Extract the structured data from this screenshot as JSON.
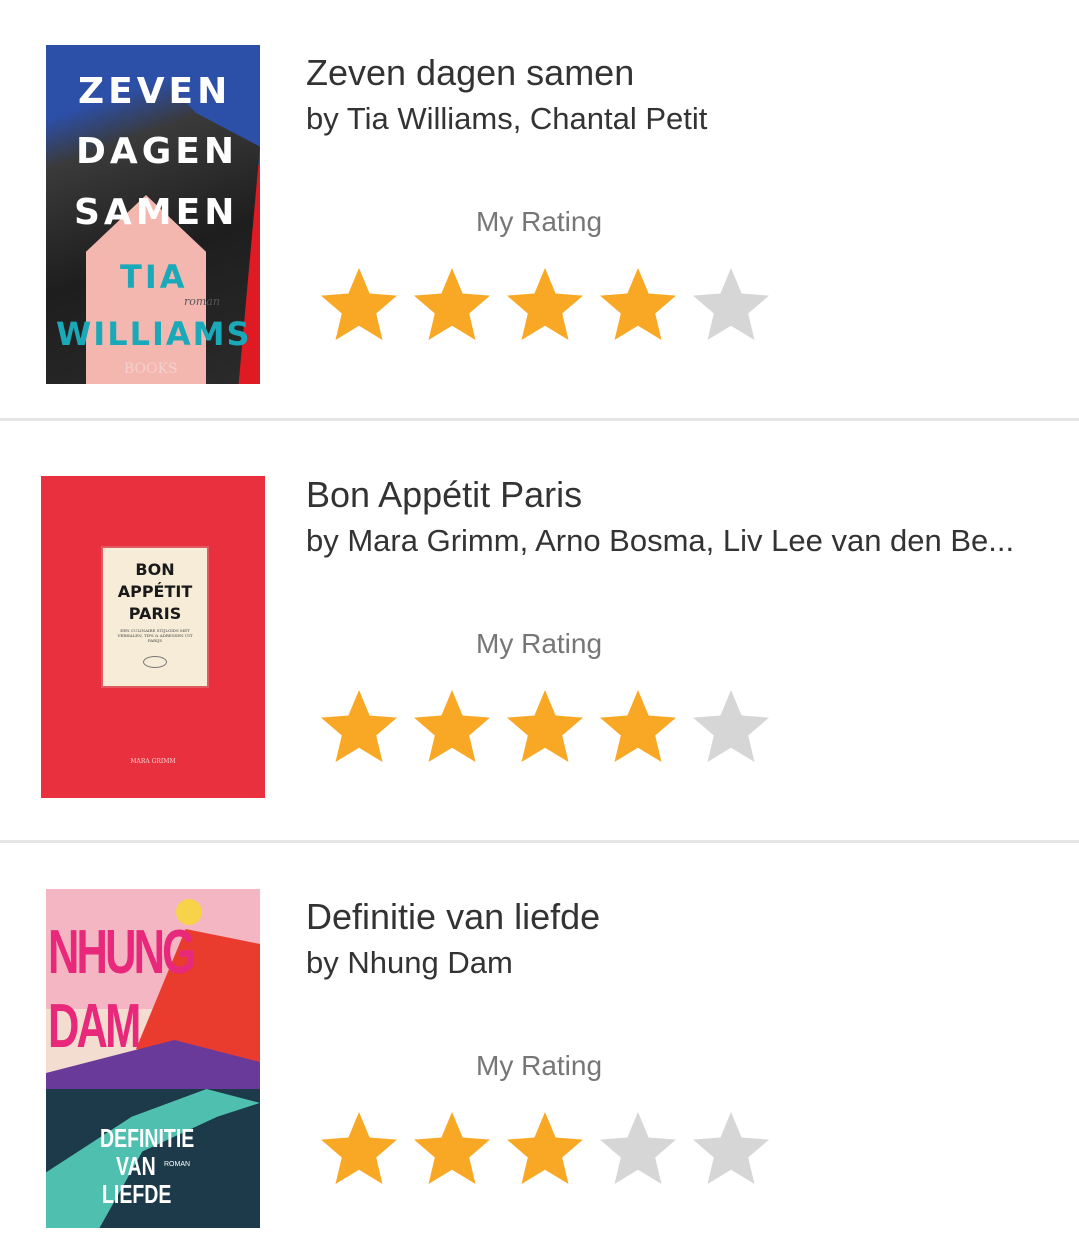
{
  "books": [
    {
      "title": "Zeven dagen samen",
      "author": "by Tia Williams, Chantal Petit",
      "rating_label": "My Rating",
      "rating": 4,
      "max_rating": 5,
      "cover": {
        "line1": "ZEVEN",
        "line2": "DAGEN",
        "line3": "SAMEN",
        "author1": "TIA",
        "author2": "WILLIAMS",
        "small": "roman",
        "publisher": "BOOKS"
      }
    },
    {
      "title": "Bon Appétit Paris",
      "author": "by Mara Grimm, Arno Bosma, Liv Lee van den Be...",
      "rating_label": "My Rating",
      "rating": 4,
      "max_rating": 5,
      "cover": {
        "line1": "BON",
        "line2": "APPÉTIT",
        "line3": "PARIS",
        "subtitle": "EEN CULINAIRE STIJLGIDS MET VERHALEN, TIPS & ADRESSEN UIT PARIJS",
        "author": "MARA GRIMM"
      }
    },
    {
      "title": "Definitie van liefde",
      "author": "by Nhung Dam",
      "rating_label": "My Rating",
      "rating": 3,
      "max_rating": 5,
      "cover": {
        "author1": "NHUNG",
        "author2": "DAM",
        "line1": "DEFINITIE",
        "line2": "VAN",
        "line3": "LIEFDE",
        "small": "ROMAN"
      }
    }
  ],
  "colors": {
    "star_filled": "#f9a825",
    "star_empty": "#d6d6d6"
  }
}
